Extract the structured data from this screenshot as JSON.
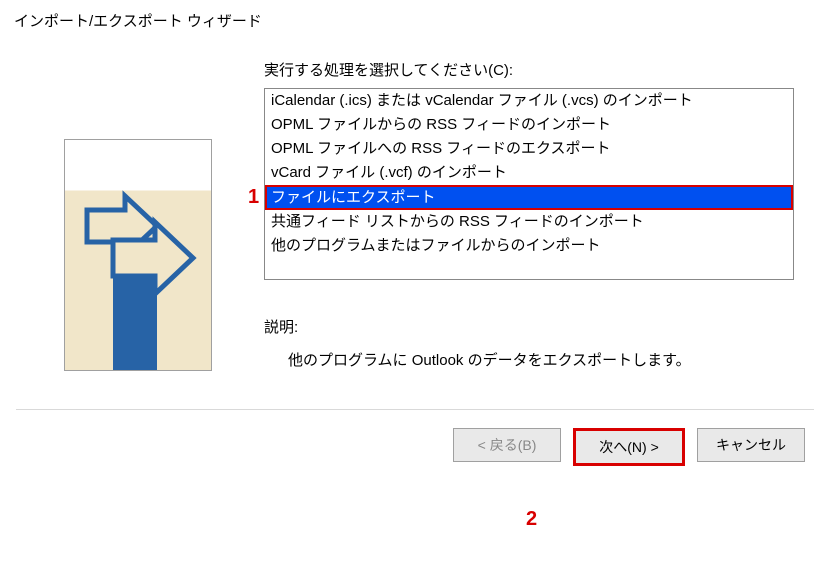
{
  "window_title": "インポート/エクスポート ウィザード",
  "prompt_label": "実行する処理を選択してください(C):",
  "list_items": [
    "iCalendar (.ics) または vCalendar ファイル (.vcs) のインポート",
    "OPML ファイルからの RSS フィードのインポート",
    "OPML ファイルへの RSS フィードのエクスポート",
    "vCard ファイル (.vcf) のインポート",
    "ファイルにエクスポート",
    "共通フィード リストからの RSS フィードのインポート",
    "他のプログラムまたはファイルからのインポート"
  ],
  "selected_index": 4,
  "description_label": "説明:",
  "description_text": "他のプログラムに Outlook のデータをエクスポートします。",
  "buttons": {
    "back": "< 戻る(B)",
    "next": "次へ(N) >",
    "cancel": "キャンセル"
  },
  "annotations": {
    "one": "1",
    "two": "2"
  }
}
